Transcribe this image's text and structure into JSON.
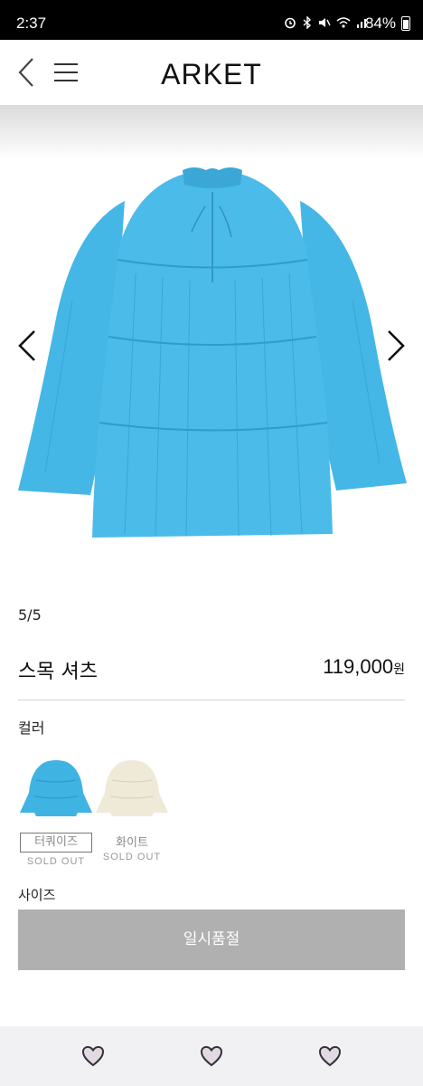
{
  "status_bar": {
    "time": "2:37",
    "battery": "84%"
  },
  "header": {
    "brand": "ARKET"
  },
  "gallery": {
    "counter": "5/5"
  },
  "product": {
    "name": "스목 셔츠",
    "price": "119,000",
    "currency": "원"
  },
  "color_section": {
    "label": "컬러",
    "options": [
      {
        "name": "터쿼이즈",
        "status": "SOLD OUT",
        "color": "#3fb4e3",
        "selected": true
      },
      {
        "name": "화이트",
        "status": "SOLD OUT",
        "color": "#efe9d8",
        "selected": false
      }
    ]
  },
  "size_section": {
    "label": "사이즈",
    "button_label": "일시품절"
  },
  "colors": {
    "product": "#45b7e6",
    "button": "#b0b0b0",
    "bottom_bar": "#f1f1f3"
  },
  "bottom_nav": {
    "icons": [
      "heart-icon",
      "heart-icon",
      "heart-icon"
    ]
  }
}
